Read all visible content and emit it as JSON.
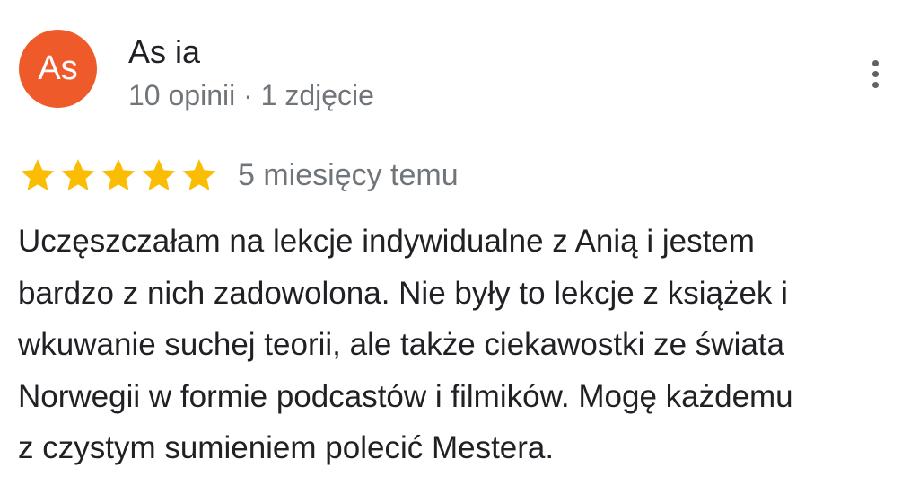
{
  "review": {
    "author": {
      "initials": "As",
      "name": "As ia",
      "meta": "10 opinii · 1 zdjęcie",
      "avatar_color": "#ef5a2a"
    },
    "menu_icon": "more-vert-icon",
    "rating": {
      "stars": 5,
      "max_stars": 5,
      "star_color": "#fbbc04",
      "star_icon": "star-icon"
    },
    "date": "5 miesięcy temu",
    "text": "Uczęszczałam na lekcje indywidualne z Anią i jestem\nbardzo z nich zadowolona. Nie były to  lekcje z książek i\nwkuwanie suchej teorii, ale także ciekawostki ze świata\nNorwegii w formie podcastów i filmików. Mogę każdemu\nz czystym sumieniem polecić Mestera."
  }
}
